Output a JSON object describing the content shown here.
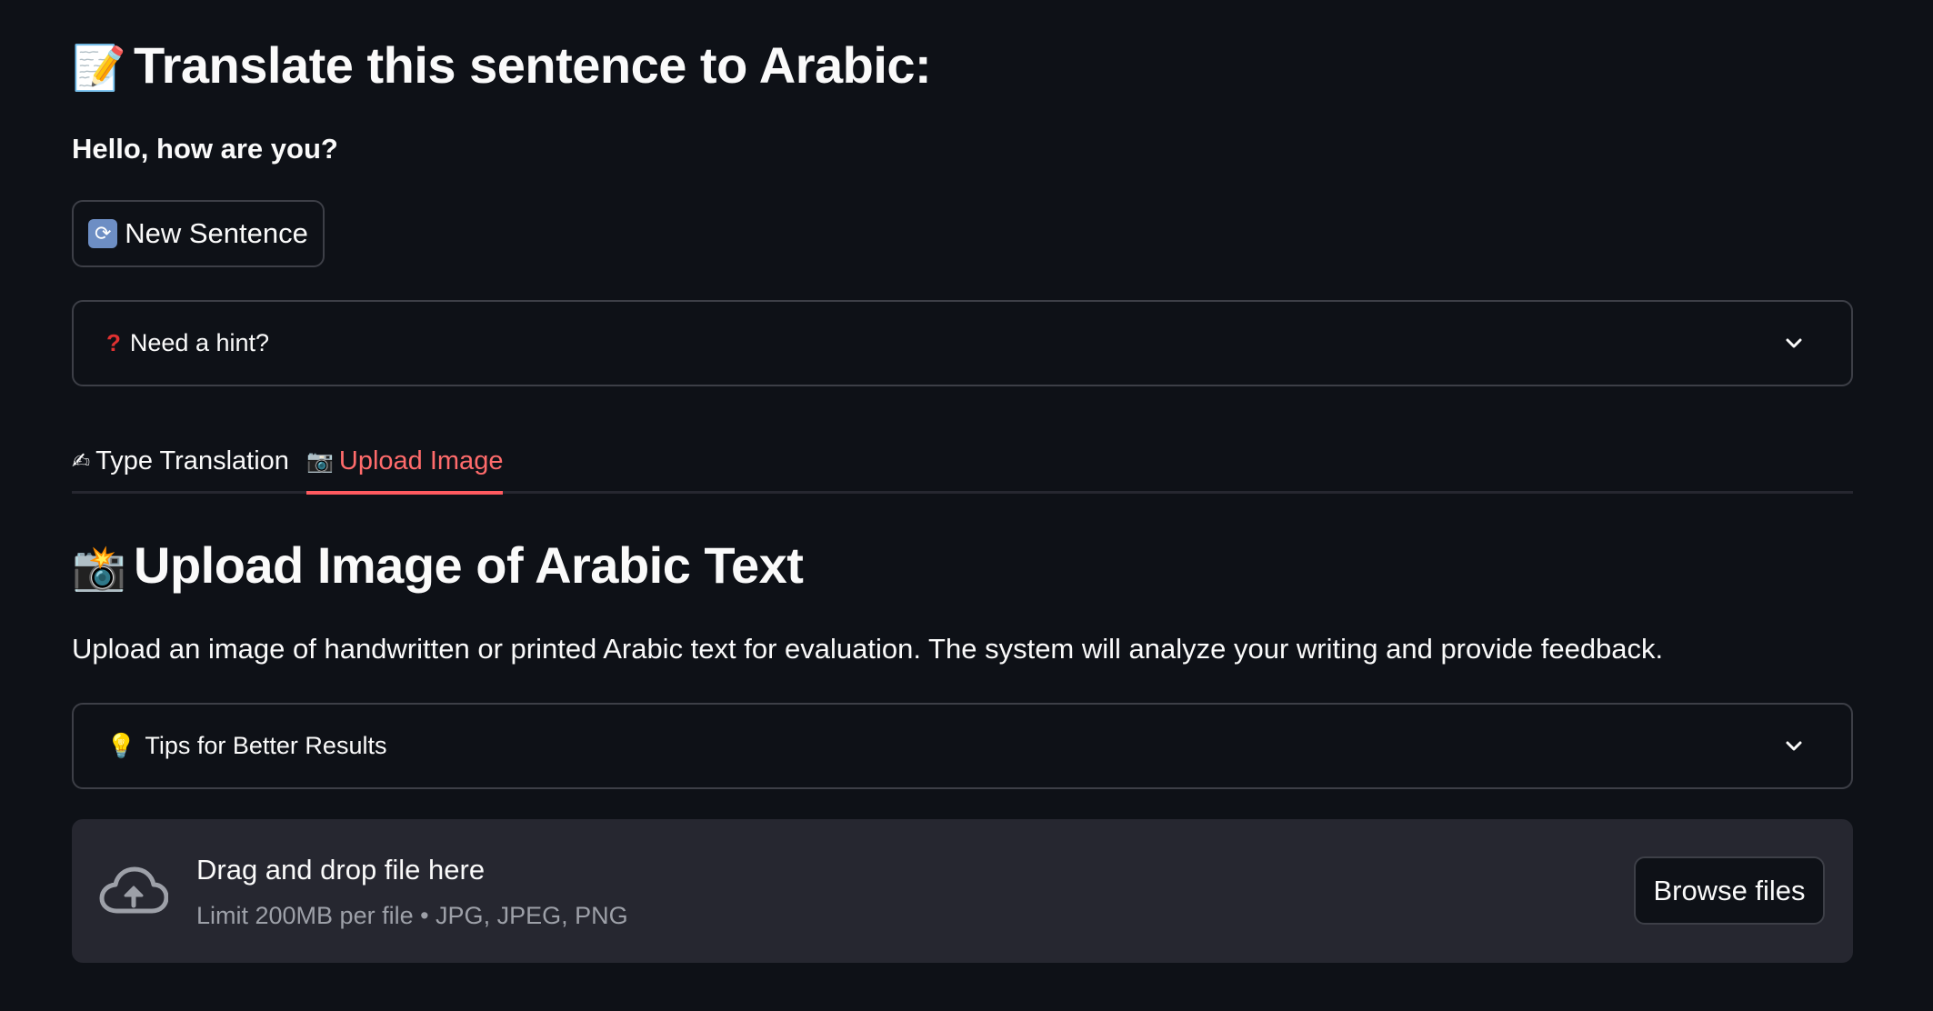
{
  "header": {
    "title_icon": "memo-icon",
    "title": "Translate this sentence to Arabic:",
    "sentence": "Hello, how are you?"
  },
  "new_sentence_button": {
    "icon": "refresh-icon",
    "label": "New Sentence"
  },
  "hint_expander": {
    "icon": "question-mark-icon",
    "label": "Need a hint?",
    "expanded": false
  },
  "tabs": [
    {
      "icon": "writing-hand-icon",
      "label": "Type Translation",
      "active": false
    },
    {
      "icon": "camera-icon",
      "label": "Upload Image",
      "active": true
    }
  ],
  "upload_section": {
    "title_icon": "camera-flash-icon",
    "title": "Upload Image of Arabic Text",
    "description": "Upload an image of handwritten or printed Arabic text for evaluation. The system will analyze your writing and provide feedback."
  },
  "tips_expander": {
    "icon": "light-bulb-icon",
    "label": "Tips for Better Results",
    "expanded": false
  },
  "file_uploader": {
    "icon": "cloud-upload-icon",
    "title": "Drag and drop file here",
    "limit": "Limit 200MB per file • JPG, JPEG, PNG",
    "browse_label": "Browse files"
  },
  "colors": {
    "background": "#0e1117",
    "accent": "#ff4b4b",
    "border": "#3d3f47",
    "dropzone": "#262730"
  }
}
